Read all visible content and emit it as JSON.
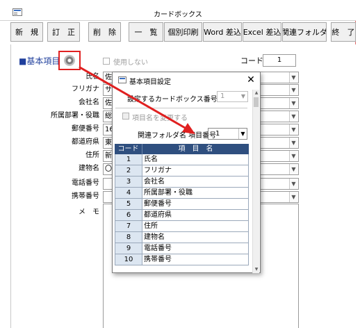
{
  "window": {
    "title": "カードボックス"
  },
  "toolbar": {
    "buttons": [
      "新　規",
      "訂　正",
      "削　除",
      "一　覧",
      "個別印刷",
      "Word 差込",
      "Excel 差込",
      "関連フォルダ",
      "終　了"
    ]
  },
  "form": {
    "section_label": "■基本項目",
    "disabled_checkbox_label": "使用しない",
    "code_label": "コード",
    "code_value": "1",
    "fields": [
      {
        "label": "氏名",
        "value": "佐"
      },
      {
        "label": "フリガナ",
        "value": "サ"
      },
      {
        "label": "会社名",
        "value": "佐"
      },
      {
        "label": "所属部署・役職",
        "value": "総"
      },
      {
        "label": "郵便番号",
        "value": "16"
      },
      {
        "label": "都道府県",
        "value": "東"
      },
      {
        "label": "住所",
        "value": "新"
      },
      {
        "label": "建物名",
        "value": "〇〇"
      },
      {
        "label": "電話番号",
        "value": ""
      },
      {
        "label": "携帯番号",
        "value": ""
      }
    ],
    "memo_label": "メ　モ"
  },
  "dialog": {
    "title": "基本項目設定",
    "close_glyph": "✕",
    "box_label": "設定するカードボックス番号",
    "box_value": "1",
    "rename_label": "項目名を変更する",
    "folder_label": "関連フォルダ名 項目番号",
    "folder_value": "1",
    "table_headers": [
      "コード",
      "項　目　名"
    ],
    "rows": [
      {
        "code": "1",
        "name": "氏名"
      },
      {
        "code": "2",
        "name": "フリガナ"
      },
      {
        "code": "3",
        "name": "会社名"
      },
      {
        "code": "4",
        "name": "所属部署・役職"
      },
      {
        "code": "5",
        "name": "郵便番号"
      },
      {
        "code": "6",
        "name": "都道府県"
      },
      {
        "code": "7",
        "name": "住所"
      },
      {
        "code": "8",
        "name": "建物名"
      },
      {
        "code": "9",
        "name": "電話番号"
      },
      {
        "code": "10",
        "name": "携帯番号"
      }
    ]
  },
  "icons": {
    "settings": "gear-icon",
    "dropdown": "chevron-down-icon",
    "close": "close-icon",
    "arrow": "red-arrow-annotation"
  },
  "colors": {
    "highlight_red": "#e02020",
    "section_blue": "#1f3f9c",
    "table_header_bg": "#2f4f7f",
    "code_cell_bg": "#dce6f1"
  }
}
